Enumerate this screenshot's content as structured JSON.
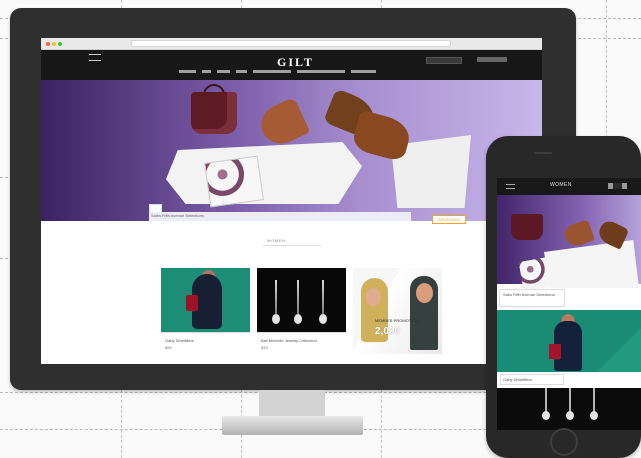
{
  "desktop": {
    "site_logo": "GILT",
    "hero_caption": "Sales Fifth Avenue Selections",
    "orange_button": "SHOP NOW",
    "section_label": "WOMEN",
    "cards": [
      {
        "title": "Gaby Dinstilliers",
        "price": "$89"
      },
      {
        "title": "Bali Michelle Jewelry Collection",
        "price": "$49"
      },
      {
        "title": "",
        "price": ""
      }
    ],
    "promo": {
      "text": "MEMBER PROMOTION",
      "price": "2,000"
    }
  },
  "phone": {
    "title": "WOMEN",
    "caption": "Saks Fifth Avenue Selections",
    "card_title": "Gaby Dinstilliers"
  },
  "colors": {
    "monitor": "#2f2f2f",
    "site_header": "#171717",
    "hero_purple": "#7b5ca8",
    "promo_green": "#1d8d76",
    "accent_orange": "#f6a428"
  }
}
